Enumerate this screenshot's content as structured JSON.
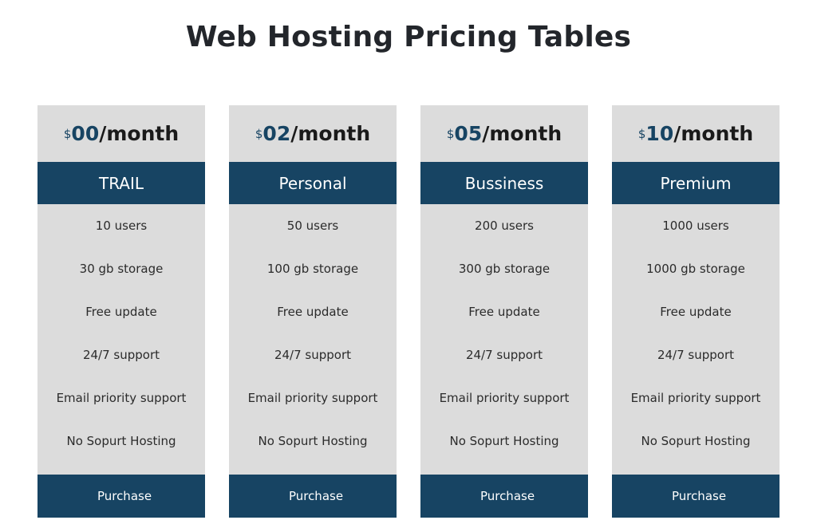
{
  "page": {
    "title": "Web Hosting Pricing Tables"
  },
  "colors": {
    "primary": "#174463",
    "card_bg": "#dcdcdc"
  },
  "plans": [
    {
      "currency": "$",
      "amount": "00",
      "period": "/month",
      "name": "TRAIL",
      "features": [
        "10 users",
        "30 gb storage",
        "Free update",
        "24/7 support",
        "Email priority support",
        "No Sopurt Hosting"
      ],
      "button": "Purchase"
    },
    {
      "currency": "$",
      "amount": "02",
      "period": "/month",
      "name": "Personal",
      "features": [
        "50 users",
        "100 gb storage",
        "Free update",
        "24/7 support",
        "Email priority support",
        "No Sopurt Hosting"
      ],
      "button": "Purchase"
    },
    {
      "currency": "$",
      "amount": "05",
      "period": "/month",
      "name": "Bussiness",
      "features": [
        "200 users",
        "300 gb storage",
        "Free update",
        "24/7 support",
        "Email priority support",
        "No Sopurt Hosting"
      ],
      "button": "Purchase"
    },
    {
      "currency": "$",
      "amount": "10",
      "period": "/month",
      "name": "Premium",
      "features": [
        "1000 users",
        "1000 gb storage",
        "Free update",
        "24/7 support",
        "Email priority support",
        "No Sopurt Hosting"
      ],
      "button": "Purchase"
    }
  ]
}
